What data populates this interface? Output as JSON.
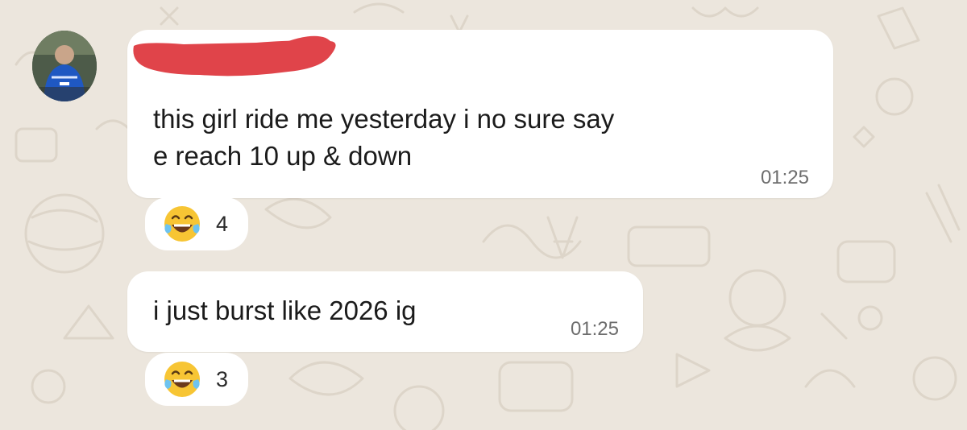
{
  "conversation": {
    "messages": [
      {
        "text": "this girl ride me yesterday i no sure say\ne reach 10 up & down",
        "time": "01:25",
        "reaction": {
          "emoji": "laughing-with-tears-emoji",
          "count": "4"
        }
      },
      {
        "text": "i just burst like 2026 ig",
        "time": "01:25",
        "reaction": {
          "emoji": "laughing-with-tears-emoji",
          "count": "3"
        }
      }
    ]
  },
  "colors": {
    "background": "#ece6dd",
    "bubble": "#ffffff",
    "redaction": "#e0444a",
    "time_text": "#6d6d6d"
  }
}
